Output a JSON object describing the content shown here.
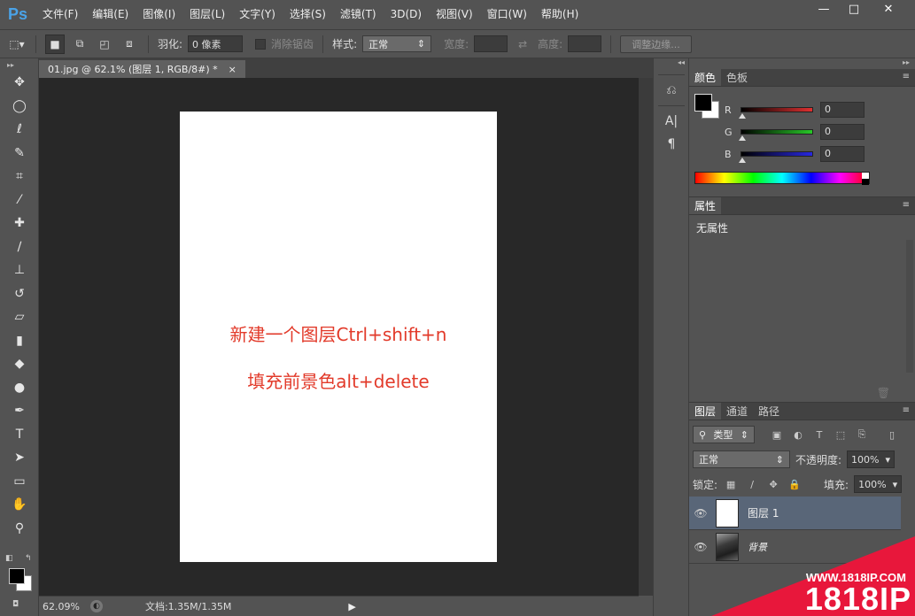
{
  "app": {
    "logo": "Ps",
    "menu": [
      "文件(F)",
      "编辑(E)",
      "图像(I)",
      "图层(L)",
      "文字(Y)",
      "选择(S)",
      "滤镜(T)",
      "3D(D)",
      "视图(V)",
      "窗口(W)",
      "帮助(H)"
    ],
    "window_controls": {
      "minimize": "—",
      "maximize": "□",
      "close": "✕"
    }
  },
  "options_bar": {
    "feather_label": "羽化:",
    "feather_value": "0 像素",
    "antialias_label": "消除锯齿",
    "style_label": "样式:",
    "style_value": "正常",
    "width_label": "宽度:",
    "height_label": "高度:",
    "refine_edge_label": "调整边缘..."
  },
  "document": {
    "tab_title": "01.jpg @ 62.1% (图层 1, RGB/8#) *",
    "tab_close": "×",
    "line1": "新建一个图层Ctrl+shift+n",
    "line2": "填充前景色alt+delete"
  },
  "status": {
    "zoom": "62.09%",
    "doc_info": "文档:1.35M/1.35M",
    "arrow": "▶"
  },
  "color_panel": {
    "tabs": [
      "颜色",
      "色板"
    ],
    "r_label": "R",
    "r_value": "0",
    "g_label": "G",
    "g_value": "0",
    "b_label": "B",
    "b_value": "0",
    "colors": {
      "red": "#e03030",
      "green": "#28c828",
      "blue": "#2828e0"
    }
  },
  "properties_panel": {
    "tab": "属性",
    "no_properties": "无属性"
  },
  "layers_panel": {
    "tabs": [
      "图层",
      "通道",
      "路径"
    ],
    "filter_type": "类型",
    "blend_mode": "正常",
    "opacity_label": "不透明度:",
    "opacity_value": "100%",
    "lock_label": "锁定:",
    "fill_label": "填充:",
    "fill_value": "100%",
    "layers": [
      {
        "name": "图层 1",
        "selected": true
      },
      {
        "name": "背景",
        "selected": false
      }
    ]
  },
  "watermark": {
    "url": "WWW.1818IP.COM",
    "brand": "1818IP"
  }
}
